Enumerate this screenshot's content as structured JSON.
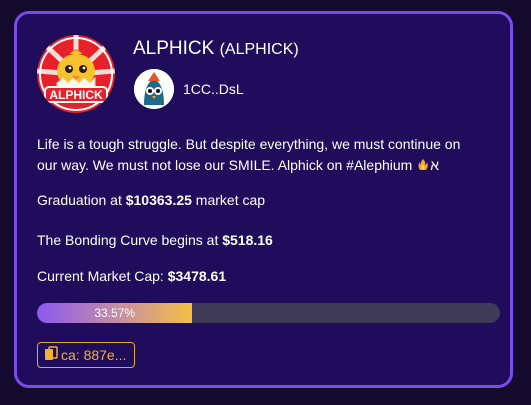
{
  "token": {
    "name": "ALPHICK",
    "symbol": "(ALPHICK)",
    "logo_text": "ALPHICK",
    "description": "Life is a tough struggle. But despite everything, we must continue on our way. We must not lose our SMILE. Alphick on #Alephium",
    "description_suffix": "א"
  },
  "creator": {
    "name": "1CC..DsL"
  },
  "graduation": {
    "prefix": "Graduation at ",
    "value": "$10363.25",
    "suffix": " market cap"
  },
  "bonding": {
    "prefix": "The Bonding Curve begins at ",
    "value": "$518.16"
  },
  "market_cap": {
    "prefix": "Current Market Cap: ",
    "value": "$3478.61"
  },
  "progress": {
    "label": "33.57%",
    "percent": 33.57,
    "fill_color": "#f5c043",
    "track_color": "#3f3a58"
  },
  "contract": {
    "label": "ca: 887e..."
  },
  "colors": {
    "background": "#1f0c5a",
    "border": "#7a4ee6",
    "accent": "#f2b233"
  },
  "icons": {
    "copy": "copy-icon",
    "emoji": "fire-hand-icon"
  }
}
